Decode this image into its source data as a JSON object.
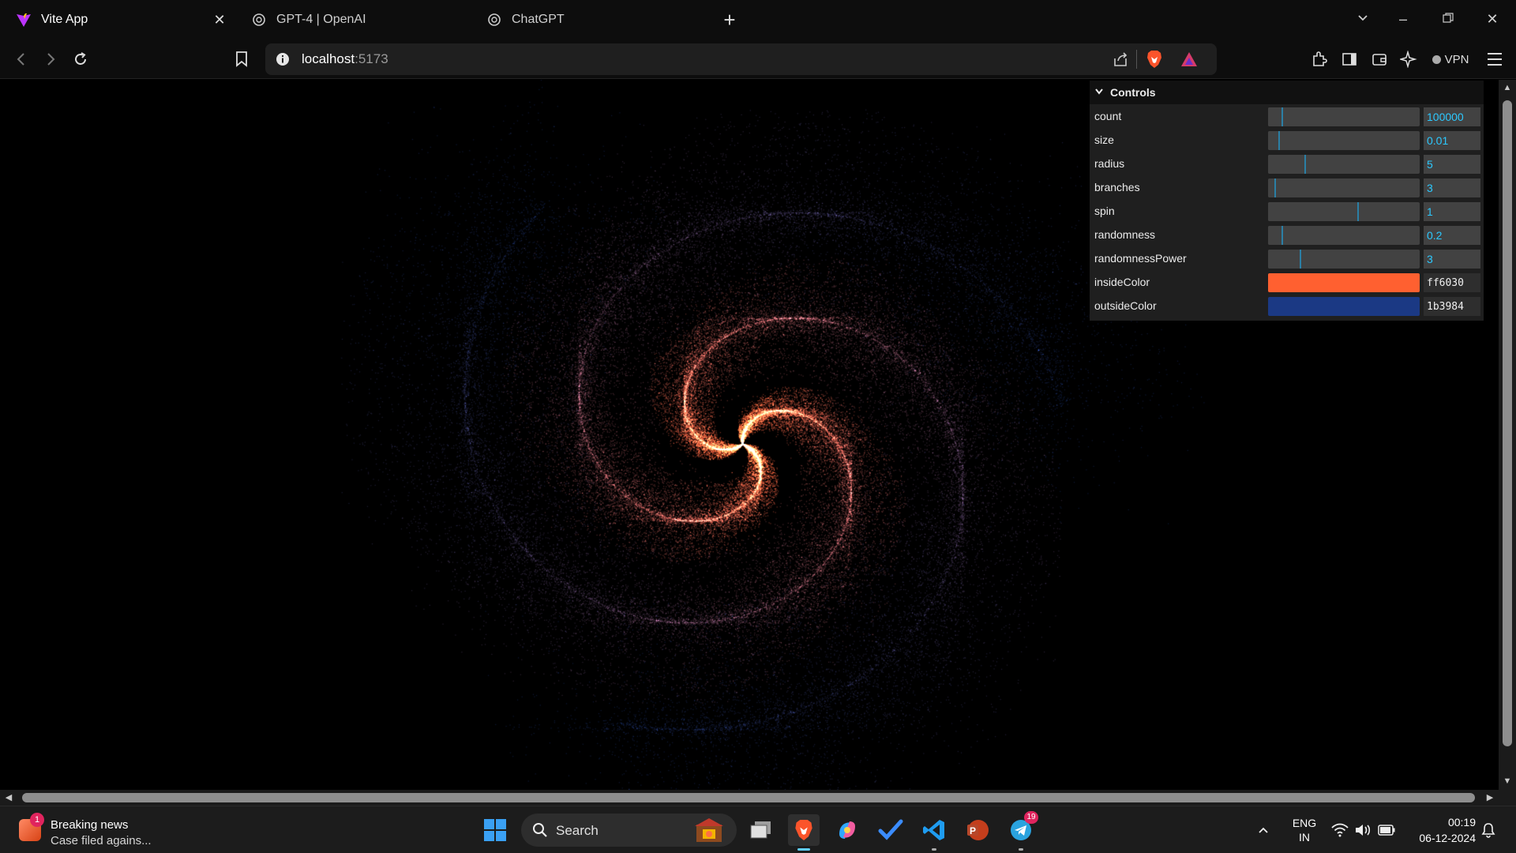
{
  "browser": {
    "tabs": [
      {
        "title": "Vite App",
        "icon": "vite-logo-icon",
        "active": true
      },
      {
        "title": "GPT-4 | OpenAI",
        "icon": "openai-logo-icon",
        "active": false
      },
      {
        "title": "ChatGPT",
        "icon": "openai-logo-icon",
        "active": false
      }
    ],
    "url_host": "localhost",
    "url_port": ":5173",
    "vpn_label": "VPN"
  },
  "controls": {
    "title": "Controls",
    "numeric": [
      {
        "label": "count",
        "value": "100000",
        "fraction": 0.1
      },
      {
        "label": "size",
        "value": "0.01",
        "fraction": 0.08
      },
      {
        "label": "radius",
        "value": "5",
        "fraction": 0.25
      },
      {
        "label": "branches",
        "value": "3",
        "fraction": 0.05
      },
      {
        "label": "spin",
        "value": "1",
        "fraction": 0.6
      },
      {
        "label": "randomness",
        "value": "0.2",
        "fraction": 0.1
      },
      {
        "label": "randomnessPower",
        "value": "3",
        "fraction": 0.22
      }
    ],
    "colors": [
      {
        "label": "insideColor",
        "value": "ff6030",
        "swatch": "#ff6030"
      },
      {
        "label": "outsideColor",
        "value": "1b3984",
        "swatch": "#1b3984"
      }
    ]
  },
  "galaxy": {
    "count": 100000,
    "size": 0.01,
    "radius": 5,
    "branches": 3,
    "spin": 1,
    "randomness": 0.2,
    "randomnessPower": 3,
    "insideColor": "#ff6030",
    "outsideColor": "#1b3984"
  },
  "taskbar": {
    "news_title": "Breaking news",
    "news_sub": "Case filed agains...",
    "news_badge": "1",
    "search_placeholder": "Search",
    "telegram_badge": "19",
    "lang_top": "ENG",
    "lang_bottom": "IN",
    "time": "00:19",
    "date": "06-12-2024"
  }
}
